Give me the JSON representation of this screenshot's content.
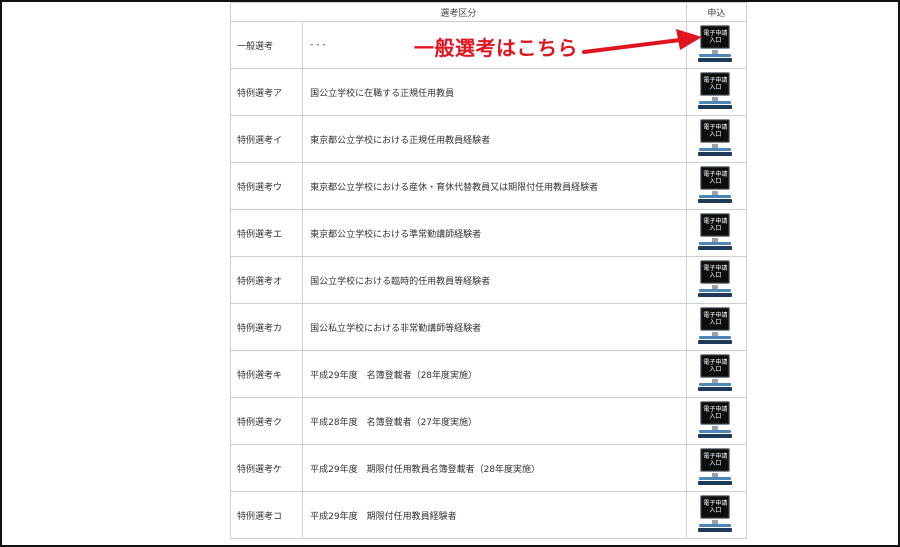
{
  "table": {
    "headers": {
      "category": "選考区分",
      "apply": "申込"
    },
    "rows": [
      {
        "category": "一般選考",
        "description": "- - -"
      },
      {
        "category": "特例選考ア",
        "description": "国公立学校に在職する正規任用教員"
      },
      {
        "category": "特例選考イ",
        "description": "東京都公立学校における正規任用教員経験者"
      },
      {
        "category": "特例選考ウ",
        "description": "東京都公立学校における産休・育休代替教員又は期限付任用教員経験者"
      },
      {
        "category": "特例選考エ",
        "description": "東京都公立学校における準常勤講師経験者"
      },
      {
        "category": "特例選考オ",
        "description": "国公立学校における臨時的任用教員等経験者"
      },
      {
        "category": "特例選考カ",
        "description": "国公私立学校における非常勤講師等経験者"
      },
      {
        "category": "特例選考キ",
        "description": "平成29年度　名簿登載者（28年度実施）"
      },
      {
        "category": "特例選考ク",
        "description": "平成28年度　名簿登載者（27年度実施）"
      },
      {
        "category": "特例選考ケ",
        "description": "平成29年度　期限付任用教員名簿登載者（28年度実施）"
      },
      {
        "category": "特例選考コ",
        "description": "平成29年度　期限付任用教員経験者"
      }
    ]
  },
  "apply_button": {
    "line1": "電子申請",
    "line2": "入口",
    "icon": "monitor-icon"
  },
  "annotation": {
    "text": "一般選考はこちら",
    "color": "#e0141e"
  }
}
